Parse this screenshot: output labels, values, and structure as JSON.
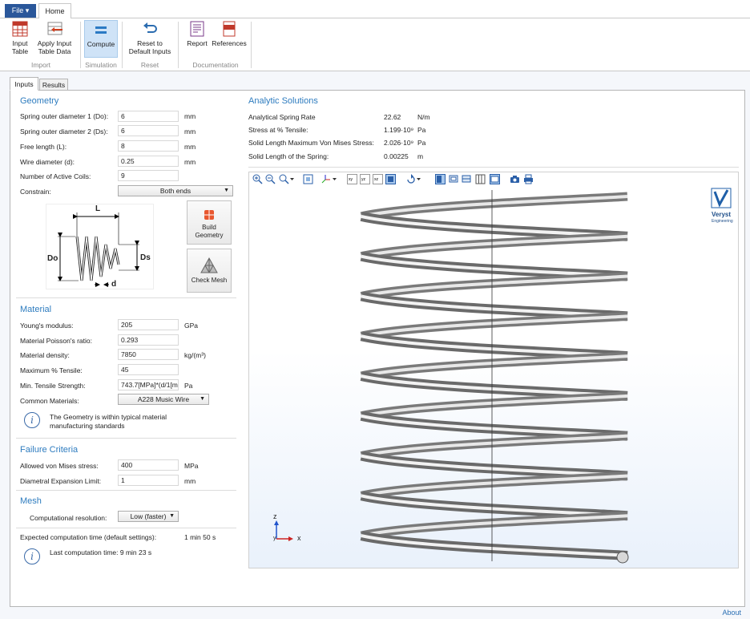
{
  "ribbon": {
    "file_label": "File ▾",
    "home_tab": "Home",
    "buttons": {
      "input_table": "Input\nTable",
      "apply_input": "Apply Input\nTable Data",
      "compute": "Compute",
      "reset": "Reset to\nDefault Inputs",
      "report": "Report",
      "references": "References"
    },
    "groups": {
      "import": "Import",
      "simulation": "Simulation",
      "reset": "Reset",
      "documentation": "Documentation"
    }
  },
  "tabs": {
    "inputs": "Inputs",
    "results": "Results"
  },
  "geometry": {
    "title": "Geometry",
    "fields": [
      {
        "label": "Spring outer diameter 1 (Do):",
        "value": "6",
        "unit": "mm"
      },
      {
        "label": "Spring outer diameter 2 (Ds):",
        "value": "6",
        "unit": "mm"
      },
      {
        "label": "Free length (L):",
        "value": "8",
        "unit": "mm"
      },
      {
        "label": "Wire diameter (d):",
        "value": "0.25",
        "unit": "mm"
      },
      {
        "label": "Number of Active Coils:",
        "value": "9",
        "unit": ""
      }
    ],
    "constrain_label": "Constrain:",
    "constrain_value": "Both ends",
    "diagram": {
      "L": "L",
      "Do": "Do",
      "Ds": "Ds",
      "d": "d"
    },
    "build_geometry": "Build\nGeometry",
    "check_mesh": "Check Mesh"
  },
  "material": {
    "title": "Material",
    "fields": [
      {
        "label": "Young's modulus:",
        "value": "205",
        "unit": "GPa"
      },
      {
        "label": "Material Poisson's ratio:",
        "value": "0.293",
        "unit": ""
      },
      {
        "label": "Material density:",
        "value": "7850",
        "unit": "kg/(m³)"
      },
      {
        "label": "Maximum % Tensile:",
        "value": "45",
        "unit": ""
      },
      {
        "label": "Min. Tensile Strength:",
        "value": "743.7[MPa]*(d/1[m",
        "unit": "Pa"
      }
    ],
    "common_label": "Common Materials:",
    "common_value": "A228 Music Wire",
    "info": "The Geometry is within typical material\nmanufacturing standards"
  },
  "failure": {
    "title": "Failure Criteria",
    "fields": [
      {
        "label": "Allowed von Mises stress:",
        "value": "400",
        "unit": "MPa"
      },
      {
        "label": "Diametral Expansion Limit:",
        "value": "1",
        "unit": "mm"
      }
    ]
  },
  "mesh": {
    "title": "Mesh",
    "resolution_label": "Computational resolution:",
    "resolution_value": "Low (faster)",
    "expected_label": "Expected computation time (default settings):",
    "expected_value": "1 min 50 s",
    "last_time": "Last computation time: 9 min 23 s"
  },
  "analytic": {
    "title": "Analytic Solutions",
    "rows": [
      {
        "label": "Analytical Spring Rate",
        "value": "22.62",
        "unit": "N/m"
      },
      {
        "label": "Stress at % Tensile:",
        "value": "1.199·10⁹",
        "unit": "Pa"
      },
      {
        "label": "Solid Length Maximum Von Mises Stress:",
        "value": "2.026·10⁹",
        "unit": "Pa"
      },
      {
        "label": "Solid Length of the Spring:",
        "value": "0.00225",
        "unit": "m"
      }
    ]
  },
  "viewer": {
    "logo_name": "Veryst",
    "logo_sub": "Engineering",
    "axis_z": "z",
    "axis_x": "x",
    "axis_y": "y"
  },
  "footer": {
    "about": "About"
  },
  "colors": {
    "accent": "#2e7cbf",
    "file_blue": "#2a579a",
    "compute_bg": "#cfe3f7"
  }
}
